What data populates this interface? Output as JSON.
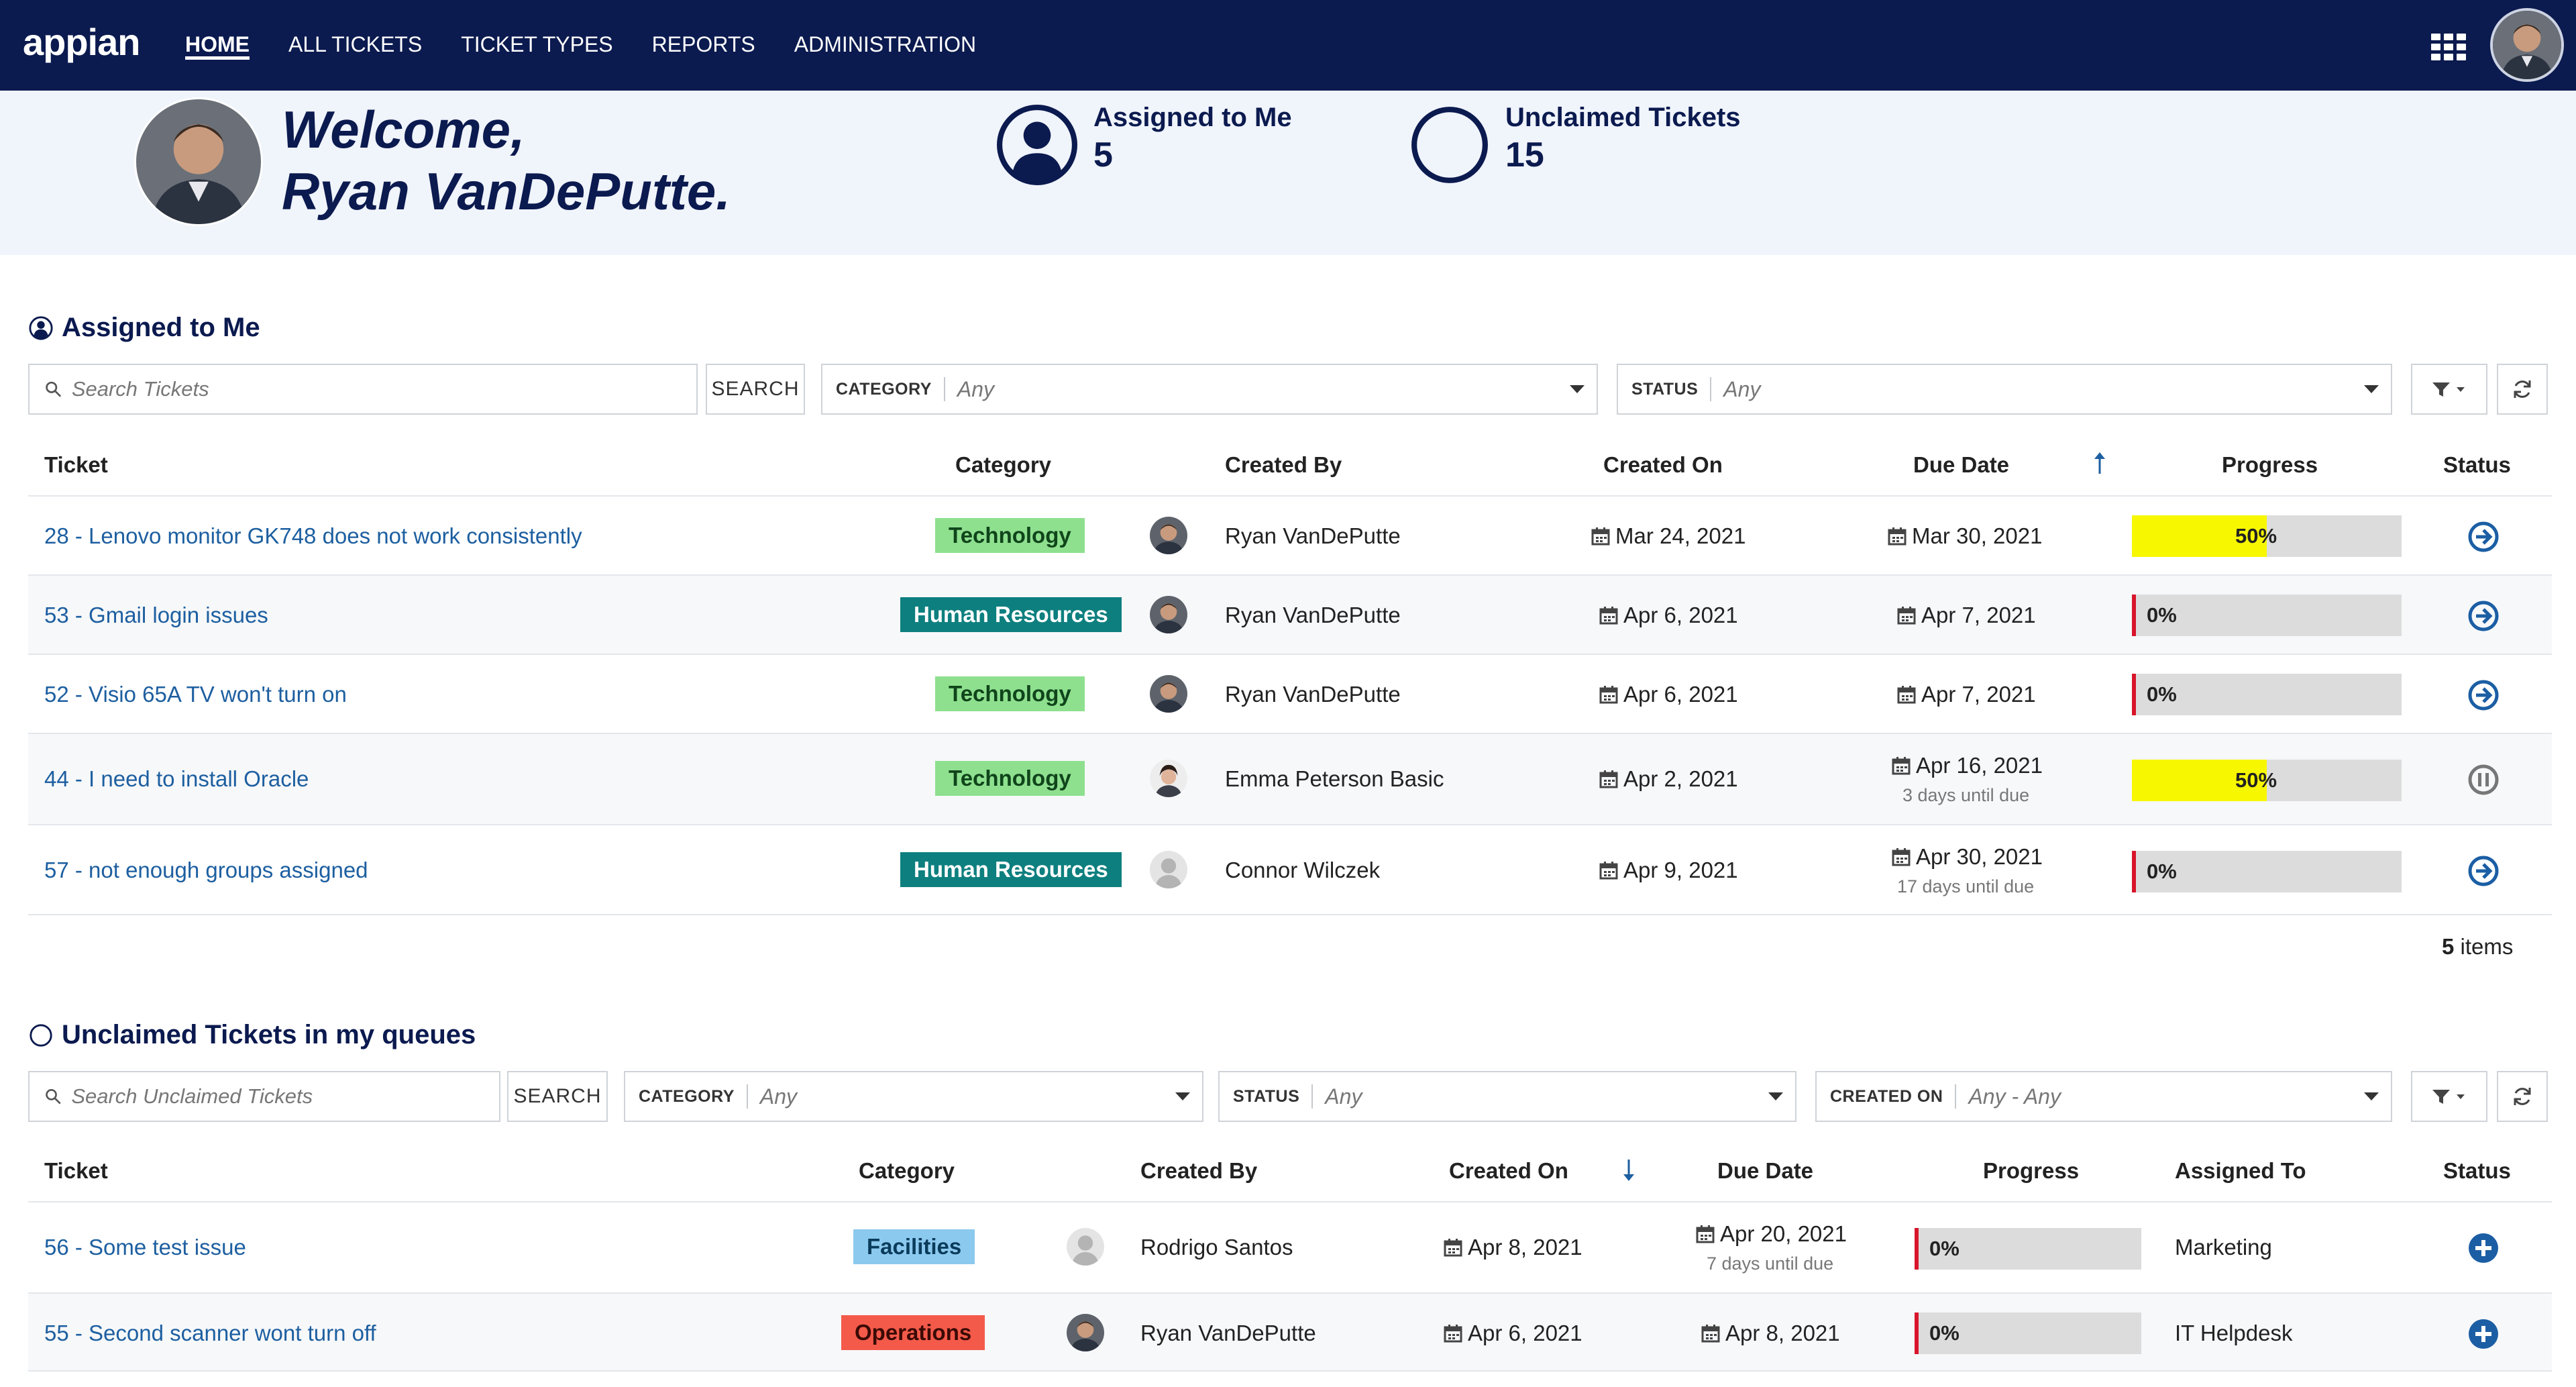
{
  "app": {
    "logo": "appian"
  },
  "nav": {
    "items": [
      {
        "label": "HOME",
        "active": true
      },
      {
        "label": "ALL TICKETS"
      },
      {
        "label": "TICKET TYPES"
      },
      {
        "label": "REPORTS"
      },
      {
        "label": "ADMINISTRATION"
      }
    ]
  },
  "hero": {
    "welcome_line1": "Welcome,",
    "welcome_line2": "Ryan VanDePutte.",
    "assigned_label": "Assigned to Me",
    "assigned_count": "5",
    "unclaimed_label": "Unclaimed Tickets",
    "unclaimed_count": "15"
  },
  "assigned": {
    "title": "Assigned to Me",
    "search_placeholder": "Search Tickets",
    "search_button": "SEARCH",
    "category_label": "CATEGORY",
    "category_value": "Any",
    "status_label": "STATUS",
    "status_value": "Any",
    "columns": [
      "Ticket",
      "Category",
      "Created By",
      "Created On",
      "Due Date",
      "Progress",
      "Status"
    ],
    "rows": [
      {
        "ticket": "28 - Lenovo monitor GK748 does not work consistently",
        "category": "Technology",
        "created_by": "Ryan VanDePutte",
        "created_on": "Mar 24, 2021",
        "due": "Mar 30, 2021",
        "due_note": "",
        "progress": "50%",
        "progress_value": 50,
        "status": "open"
      },
      {
        "ticket": "53 - Gmail login issues",
        "category": "Human Resources",
        "created_by": "Ryan VanDePutte",
        "created_on": "Apr 6, 2021",
        "due": "Apr 7, 2021",
        "due_note": "",
        "progress": "0%",
        "progress_value": 0,
        "status": "open"
      },
      {
        "ticket": "52 - Visio 65A TV won't turn on",
        "category": "Technology",
        "created_by": "Ryan VanDePutte",
        "created_on": "Apr 6, 2021",
        "due": "Apr 7, 2021",
        "due_note": "",
        "progress": "0%",
        "progress_value": 0,
        "status": "open"
      },
      {
        "ticket": "44 - I need to install Oracle",
        "category": "Technology",
        "created_by": "Emma Peterson Basic",
        "created_on": "Apr 2, 2021",
        "due": "Apr 16, 2021",
        "due_note": "3 days until due",
        "progress": "50%",
        "progress_value": 50,
        "status": "paused"
      },
      {
        "ticket": "57 - not enough groups assigned",
        "category": "Human Resources",
        "created_by": "Connor Wilczek",
        "created_on": "Apr 9, 2021",
        "due": "Apr 30, 2021",
        "due_note": "17 days until due",
        "progress": "0%",
        "progress_value": 0,
        "status": "open"
      }
    ],
    "items_count": "5",
    "items_suffix": " items"
  },
  "unclaimed": {
    "title": "Unclaimed Tickets in my queues",
    "search_placeholder": "Search Unclaimed Tickets",
    "search_button": "SEARCH",
    "category_label": "CATEGORY",
    "category_value": "Any",
    "status_label": "STATUS",
    "status_value": "Any",
    "created_label": "CREATED ON",
    "created_value": "Any - Any",
    "columns": [
      "Ticket",
      "Category",
      "Created By",
      "Created On",
      "Due Date",
      "Progress",
      "Assigned To",
      "Status"
    ],
    "rows": [
      {
        "ticket": "56 - Some test issue",
        "category": "Facilities",
        "created_by": "Rodrigo Santos",
        "created_on": "Apr 8, 2021",
        "due": "Apr 20, 2021",
        "due_note": "7 days until due",
        "progress": "0%",
        "progress_value": 0,
        "assigned_to": "Marketing"
      },
      {
        "ticket": "55 - Second scanner wont turn off",
        "category": "Operations",
        "created_by": "Ryan VanDePutte",
        "created_on": "Apr 6, 2021",
        "due": "Apr 8, 2021",
        "due_note": "",
        "progress": "0%",
        "progress_value": 0,
        "assigned_to": "IT Helpdesk"
      }
    ]
  },
  "icons": {
    "apps": "grid-icon",
    "search": "search-icon",
    "filter": "filter-icon",
    "refresh": "refresh-icon",
    "calendar": "calendar-icon",
    "go": "arrow-circle-icon",
    "pause": "pause-circle-icon",
    "claim": "plus-circle-icon"
  },
  "colors": {
    "nav_bg": "#0b1a4f",
    "hero_bg": "#f0f4fb",
    "link": "#1d5fa0",
    "tech_tag": "#8ee08f",
    "hr_tag": "#0e7f7f",
    "facilities_tag": "#8cc9ef",
    "operations_tag": "#f45a4a",
    "progress_fill": "#f7f700",
    "progress_zero": "#d8152a",
    "status_blue": "#1b5ea4"
  }
}
